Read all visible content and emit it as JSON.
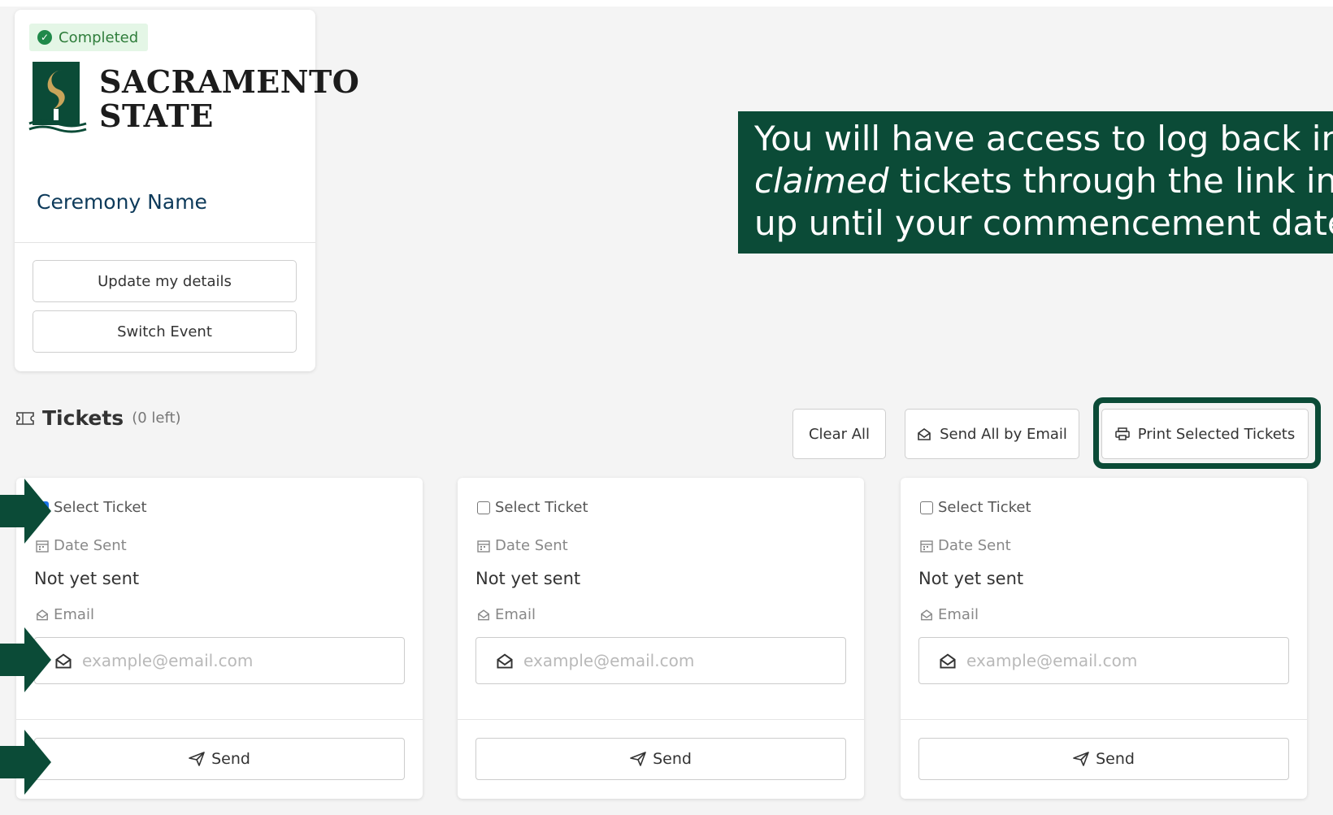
{
  "event": {
    "status_badge": "Completed",
    "logo_line1": "SACRAMENTO",
    "logo_line2": "STATE",
    "ceremony_name": "Ceremony Name",
    "update_label": "Update my details",
    "switch_label": "Switch Event"
  },
  "callout": {
    "line1": "You will have access to log back in and acc",
    "line2_italic": "claimed",
    "line2_rest": " tickets through the link in your Stu",
    "line3": "up until your commencement date."
  },
  "tickets": {
    "title": "Tickets",
    "remaining": "(0 left)",
    "clear_label": "Clear All",
    "send_all_label": "Send All by Email",
    "print_label": "Print Selected Tickets",
    "cards": [
      {
        "select_label": "Select Ticket",
        "selected": true,
        "date_label": "Date Sent",
        "date_value": "Not yet sent",
        "email_label": "Email",
        "email_placeholder": "example@email.com",
        "send_label": "Send"
      },
      {
        "select_label": "Select Ticket",
        "selected": false,
        "date_label": "Date Sent",
        "date_value": "Not yet sent",
        "email_label": "Email",
        "email_placeholder": "example@email.com",
        "send_label": "Send"
      },
      {
        "select_label": "Select Ticket",
        "selected": false,
        "date_label": "Date Sent",
        "date_value": "Not yet sent",
        "email_label": "Email",
        "email_placeholder": "example@email.com",
        "send_label": "Send"
      }
    ]
  },
  "colors": {
    "brand_green": "#0b4b37",
    "check_blue": "#1a73e8",
    "badge_green": "#20894a"
  },
  "icons": [
    "check-circle-icon",
    "ticket-icon",
    "mail-open-icon",
    "printer-icon",
    "calendar-icon",
    "send-icon",
    "arrow-right-icon"
  ]
}
